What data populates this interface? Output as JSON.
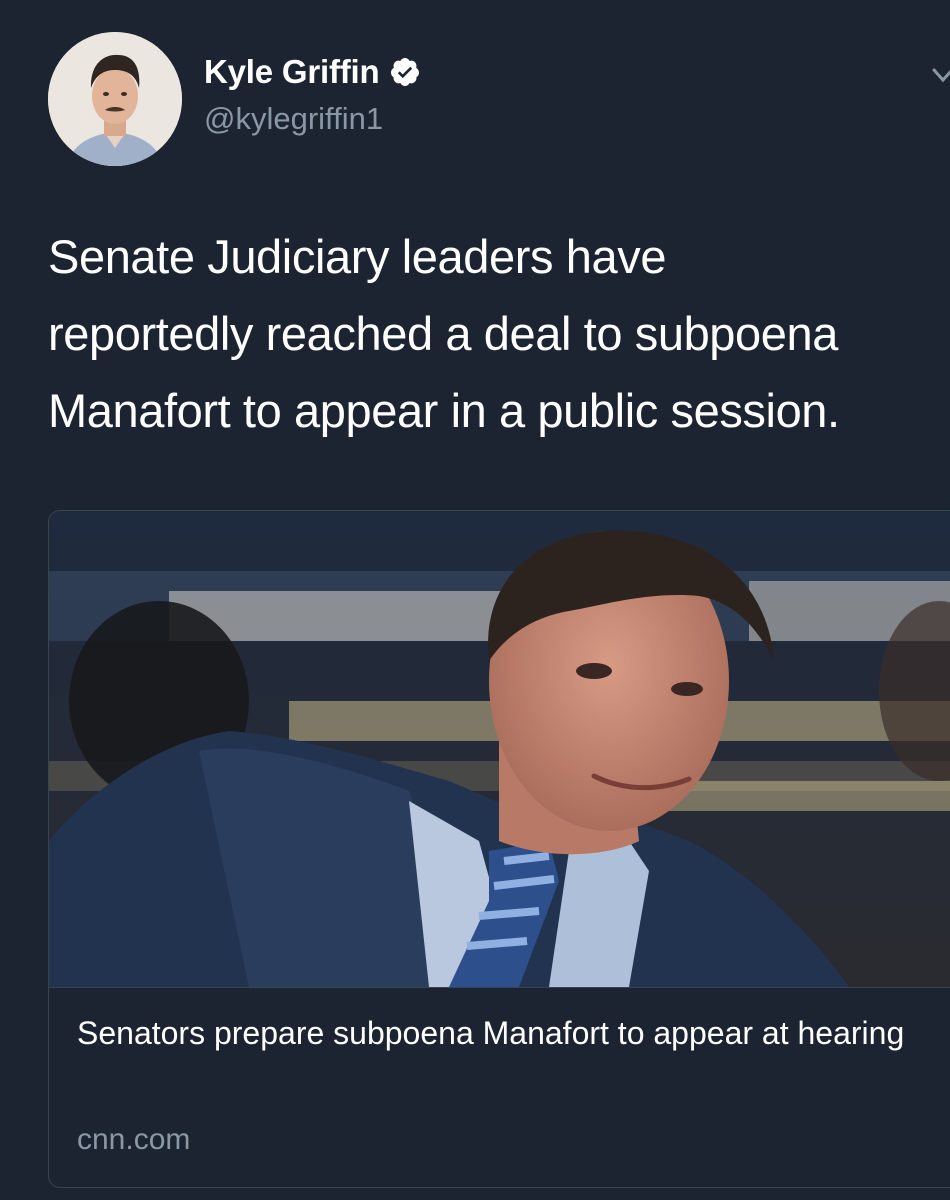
{
  "author": {
    "display_name": "Kyle Griffin",
    "handle": "@kylegriffin1",
    "verified": true,
    "avatar_icon": "user-avatar-photo"
  },
  "tweet": {
    "text_lines": [
      "Senate Judiciary leaders have",
      "reportedly reached a deal to subpoena",
      "Manafort to appear in a public session."
    ]
  },
  "card": {
    "image_icon": "news-photo",
    "title": "Senators prepare subpoena Manafort to appear at hearing",
    "domain": "cnn.com"
  },
  "colors": {
    "background": "#1c2431",
    "primary_text": "#ffffff",
    "secondary_text": "#8a97a6",
    "border": "#38444f"
  }
}
